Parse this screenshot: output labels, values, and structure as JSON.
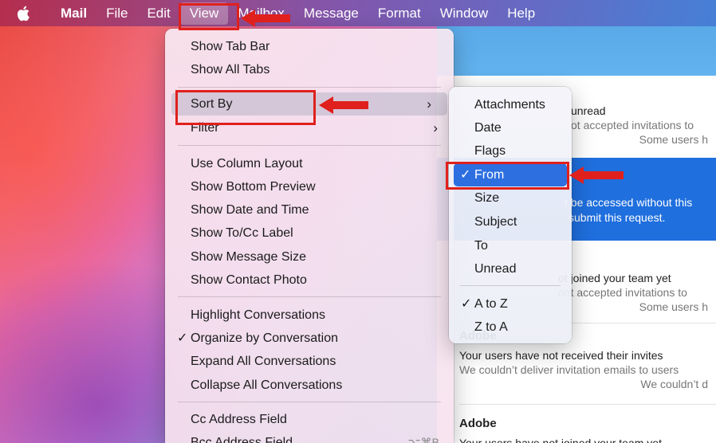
{
  "menubar": {
    "apple_icon": "apple-icon",
    "items": [
      "Mail",
      "File",
      "Edit",
      "View",
      "Mailbox",
      "Message",
      "Format",
      "Window",
      "Help"
    ],
    "active": "View"
  },
  "view_menu": {
    "items": [
      {
        "label": "Show Tab Bar"
      },
      {
        "label": "Show All Tabs"
      },
      {
        "label": "Sort By",
        "submenu": true
      },
      {
        "label": "Filter",
        "submenu": true
      },
      {
        "label": "Use Column Layout"
      },
      {
        "label": "Show Bottom Preview"
      },
      {
        "label": "Show Date and Time"
      },
      {
        "label": "Show To/Cc Label"
      },
      {
        "label": "Show Message Size"
      },
      {
        "label": "Show Contact Photo"
      },
      {
        "label": "Highlight Conversations"
      },
      {
        "label": "Organize by Conversation",
        "checked": true
      },
      {
        "label": "Expand All Conversations"
      },
      {
        "label": "Collapse All Conversations"
      },
      {
        "label": "Cc Address Field"
      },
      {
        "label": "Bcc Address Field",
        "shortcut": "⌥⌘B"
      }
    ],
    "check_mark": "✓",
    "chevron": "›"
  },
  "sort_menu": {
    "items": [
      "Attachments",
      "Date",
      "Flags",
      "From",
      "Size",
      "Subject",
      "To",
      "Unread"
    ],
    "selected": "From",
    "order_items": [
      "A to Z",
      "Z to A"
    ],
    "order_checked": "A to Z"
  },
  "mail": {
    "rows": [
      {
        "lines": [
          "unread",
          "ot accepted invitations to",
          "Some users h"
        ]
      },
      {
        "lines": [
          "t be accessed without this",
          "submit this request."
        ]
      },
      {
        "lines": [
          "ot joined your team yet",
          "not accepted invitations to",
          "Some users h"
        ]
      },
      {
        "sender": "Adobe",
        "subject": "Your users have not received their invites",
        "preview": "We couldn’t deliver invitation emails to users",
        "preview2": "We couldn’t d"
      },
      {
        "sender": "Adobe",
        "subject": "Your users have not joined your team yet"
      }
    ]
  },
  "annotation_color": "#e0201c"
}
